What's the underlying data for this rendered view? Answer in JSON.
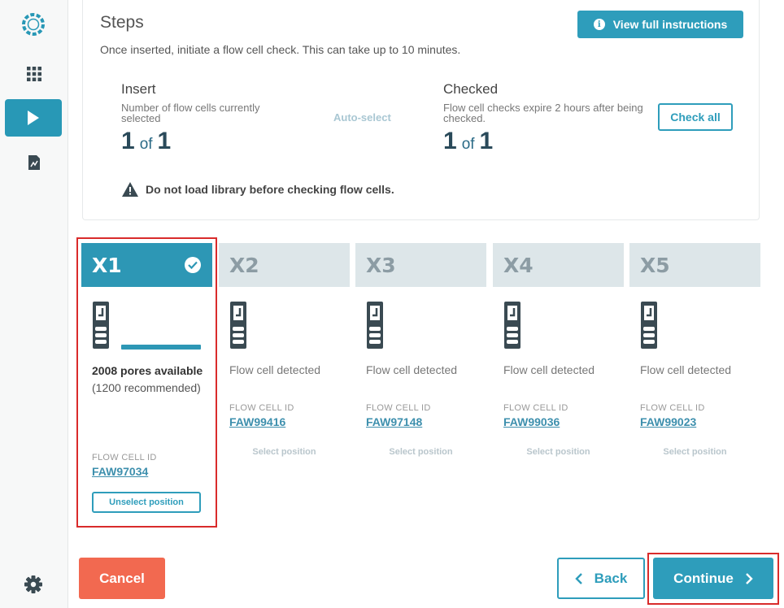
{
  "sidebar": {
    "logo_icon": "ring-logo-icon",
    "items": [
      {
        "icon": "grid-icon"
      },
      {
        "icon": "play-icon",
        "active": true
      },
      {
        "icon": "report-icon"
      }
    ],
    "settings_icon": "gear-icon"
  },
  "steps": {
    "title": "Steps",
    "subtitle": "Once inserted, initiate a flow cell check. This can take up to 10 minutes.",
    "view_button": "View full instructions",
    "insert": {
      "title": "Insert",
      "description": "Number of flow cells currently selected",
      "count": "1",
      "of": "of",
      "total": "1"
    },
    "auto_select": "Auto-select",
    "checked": {
      "title": "Checked",
      "description": "Flow cell checks expire 2 hours after being checked.",
      "count": "1",
      "of": "of",
      "total": "1"
    },
    "check_all": "Check all",
    "warning": "Do not load library before checking flow cells."
  },
  "positions": [
    {
      "label": "X1",
      "selected": true,
      "pores_bold": "2008 pores available",
      "pores_rec": "(1200 recommended)",
      "fc_label": "FLOW CELL ID",
      "fc_id": "FAW97034",
      "action": "Unselect position"
    },
    {
      "label": "X2",
      "status": "Flow cell detected",
      "fc_label": "FLOW CELL ID",
      "fc_id": "FAW99416",
      "action": "Select position"
    },
    {
      "label": "X3",
      "status": "Flow cell detected",
      "fc_label": "FLOW CELL ID",
      "fc_id": "FAW97148",
      "action": "Select position"
    },
    {
      "label": "X4",
      "status": "Flow cell detected",
      "fc_label": "FLOW CELL ID",
      "fc_id": "FAW99036",
      "action": "Select position"
    },
    {
      "label": "X5",
      "status": "Flow cell detected",
      "fc_label": "FLOW CELL ID",
      "fc_id": "FAW99023",
      "action": "Select position"
    }
  ],
  "footer": {
    "cancel": "Cancel",
    "back": "Back",
    "continue": "Continue"
  },
  "colors": {
    "accent": "#2e9dbb",
    "cancel": "#f26950",
    "highlight": "#d92b2b"
  }
}
